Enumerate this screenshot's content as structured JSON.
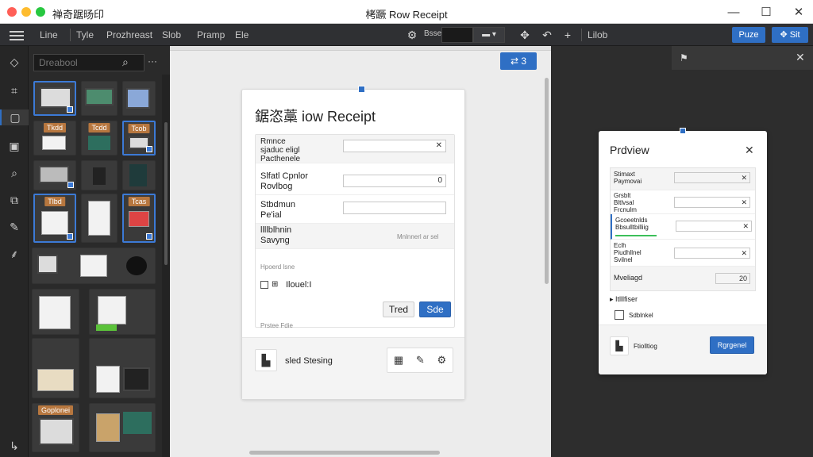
{
  "window": {
    "app_name": "禅奇踞旸印",
    "title": "栲蹶 Row Receipt"
  },
  "toolbar": {
    "items": [
      "Line",
      "Tyle",
      "Prozhreast",
      "Slob",
      "Pramp",
      "Ele"
    ],
    "field_label": "Bsse",
    "grid_label": "Lilob",
    "paste_label": "Puze",
    "share_label": "Sit"
  },
  "assets": {
    "search_placeholder": "Dreabool",
    "labels": [
      "Tkdd",
      "Tcdd",
      "Tcob",
      "Tlbd",
      "Tcas",
      "Goplonei"
    ]
  },
  "canvas": {
    "badge": "3",
    "receipt": {
      "title": "鋸恣藁 iow Receipt",
      "rows": [
        {
          "label": "Rmnce\nsjaduc eligl\nPacthenele",
          "value": ""
        },
        {
          "label": "Slfatl Cpnlor\nRovlbog",
          "value": "0"
        },
        {
          "label": "Stbdmun\nPe'ial",
          "value": ""
        },
        {
          "label": "llllblhnin\nSavyng",
          "value": ""
        }
      ],
      "note_right": "Mnlnnerl ar sel",
      "note_1": "Hpoerd lsne",
      "unit_label": "Ilouel:I",
      "note_2": "Prstee Fdie",
      "btn_cancel": "Tred",
      "btn_save": "Sde",
      "footer_label": "sled Stesing"
    }
  },
  "preview": {
    "title": "Prdview",
    "rows": [
      {
        "label": "Stimaxt\nPaymovai",
        "value": ""
      },
      {
        "label": "Grsblt\nBltlvsal\nFrcnulm",
        "value": ""
      },
      {
        "label": "Gcoeetnlds\nBbsulltbilliig",
        "value": ""
      },
      {
        "label": "Eclh\nPiudhllnel\nSvilnel",
        "value": ""
      }
    ],
    "qty_label": "Mveliagd",
    "qty_value": "20",
    "section_label": "▸ Itlllfiser",
    "check_label": "Sdblnkel",
    "footer_label": "Ftiolltiog",
    "footer_btn": "Rgrgenel"
  }
}
